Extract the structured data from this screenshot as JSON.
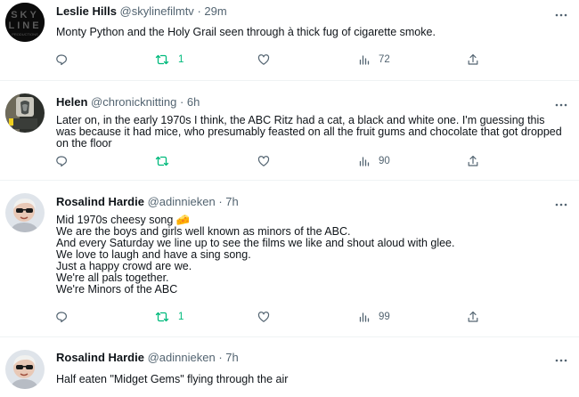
{
  "tweets": [
    {
      "name": "Leslie Hills",
      "handle": "@skylinefilmtv",
      "separator": "·",
      "time": "29m",
      "avatar_text": [
        "SKY",
        "LINE",
        "PRODUCTIONS"
      ],
      "text": "Monty Python and the Holy Grail seen through à thick fug of cigarette smoke.",
      "retweets": "1",
      "views": "72"
    },
    {
      "name": "Helen",
      "handle": "@chronicknitting",
      "separator": "·",
      "time": "6h",
      "text": "Later on, in the early 1970s I think, the ABC Ritz had a cat, a black and white one. I'm guessing this was because it had mice, who presumably feasted on all the fruit gums and chocolate that got dropped on the floor",
      "retweets": "",
      "views": "90"
    },
    {
      "name": "Rosalind Hardie",
      "handle": "@adinnieken",
      "separator": "·",
      "time": "7h",
      "text": "Mid 1970s cheesy song 🧀\nWe are the boys and girls well known as minors of the ABC.\nAnd every Saturday we line up to see the films we like and shout aloud with glee.\nWe love to laugh and have a sing song.\nJust a happy crowd are we.\nWe're all pals together.\nWe're Minors of the ABC",
      "retweets": "1",
      "views": "99"
    },
    {
      "name": "Rosalind Hardie",
      "handle": "@adinnieken",
      "separator": "·",
      "time": "7h",
      "text": "Half eaten \"Midget Gems\" flying through the air"
    }
  ],
  "colors": {
    "text": "#0f1419",
    "secondary": "#536471",
    "retweet_green": "#00ba7c",
    "divider": "#eff3f4"
  },
  "icons": [
    "reply-icon",
    "retweet-icon",
    "like-icon",
    "views-icon",
    "share-icon",
    "more-icon"
  ]
}
